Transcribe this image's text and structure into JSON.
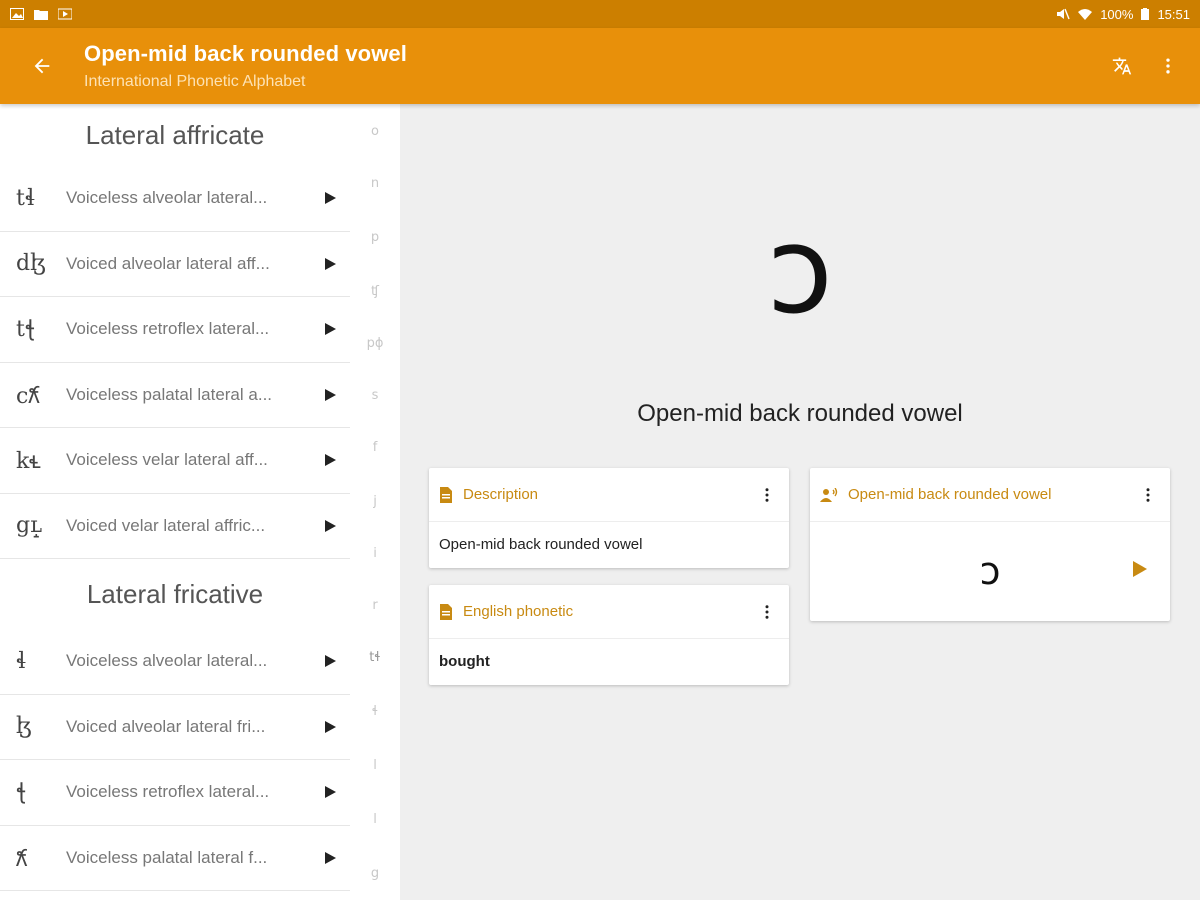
{
  "statusbar": {
    "battery": "100%",
    "time": "15:51"
  },
  "appbar": {
    "title": "Open-mid back rounded vowel",
    "subtitle": "International Phonetic Alphabet"
  },
  "sidebar": {
    "section1_title": "Lateral affricate",
    "section1_items": [
      {
        "symbol": "tɬ",
        "name": "Voiceless alveolar lateral..."
      },
      {
        "symbol": "dɮ",
        "name": "Voiced alveolar lateral aff..."
      },
      {
        "symbol": "tꞎ",
        "name": "Voiceless retroflex lateral..."
      },
      {
        "symbol": "c𝼆",
        "name": "Voiceless palatal lateral a..."
      },
      {
        "symbol": "k𝼄",
        "name": "Voiceless velar lateral aff..."
      },
      {
        "symbol": "gʟ̝",
        "name": "Voiced velar lateral affric..."
      }
    ],
    "section2_title": "Lateral fricative",
    "section2_items": [
      {
        "symbol": "ɬ",
        "name": "Voiceless alveolar lateral..."
      },
      {
        "symbol": "ɮ",
        "name": "Voiced alveolar lateral fri..."
      },
      {
        "symbol": "ꞎ",
        "name": "Voiceless retroflex lateral..."
      },
      {
        "symbol": "𝼆",
        "name": "Voiceless palatal lateral f..."
      }
    ],
    "index_letters": [
      "o",
      "n",
      "p",
      "ʧ",
      "pɸ",
      "s",
      "f",
      "j",
      "i",
      "r",
      "tɬ",
      "ɬ",
      "l",
      "l",
      "g"
    ]
  },
  "main": {
    "symbol": "ɔ",
    "name": "Open-mid back rounded vowel",
    "description": {
      "title": "Description",
      "value": "Open-mid back rounded vowel"
    },
    "english": {
      "title": "English phonetic",
      "value": "bought"
    },
    "audio": {
      "title": "Open-mid back rounded vowel",
      "symbol": "ɔ"
    }
  },
  "colors": {
    "statusbar": "#cc7f00",
    "appbar": "#e8900a",
    "accent": "#c88a12"
  }
}
